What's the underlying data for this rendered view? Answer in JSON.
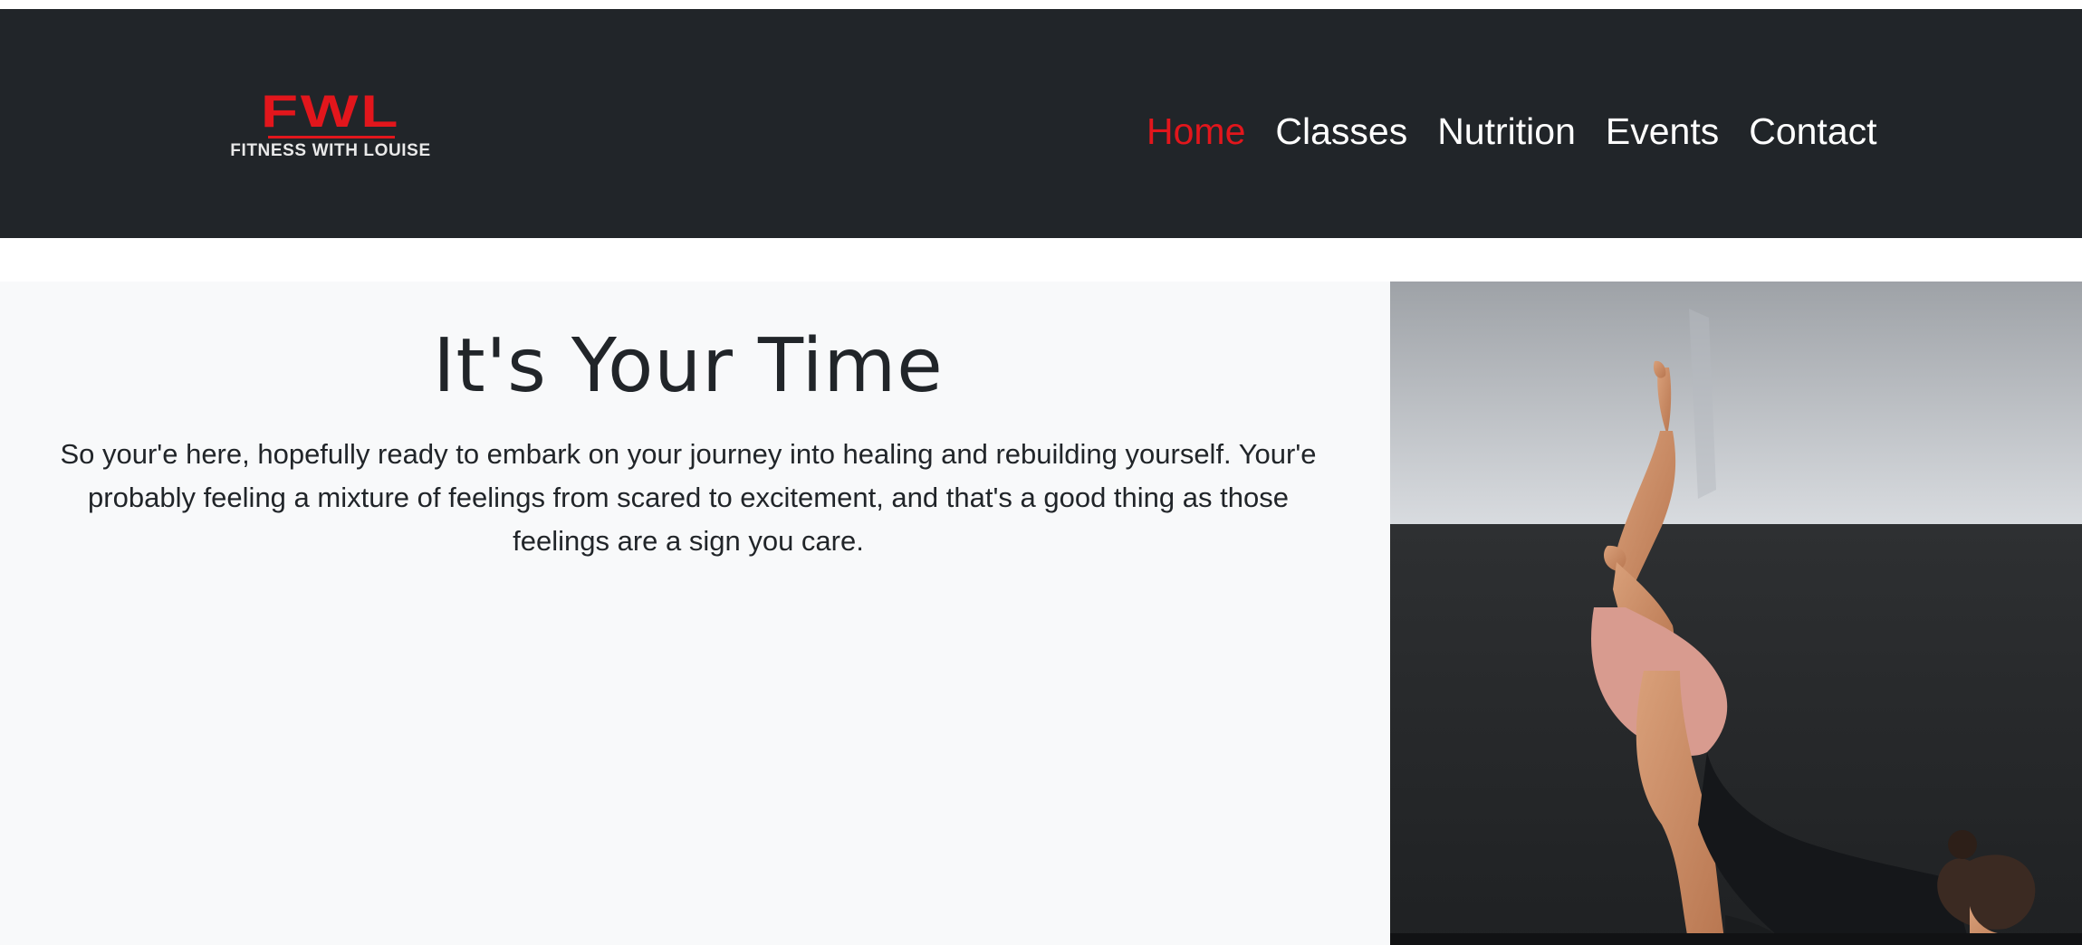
{
  "logo": {
    "mark": "FWL",
    "tagline": "FITNESS WITH LOUISE"
  },
  "nav": {
    "items": [
      {
        "label": "Home",
        "active": true
      },
      {
        "label": "Classes",
        "active": false
      },
      {
        "label": "Nutrition",
        "active": false
      },
      {
        "label": "Events",
        "active": false
      },
      {
        "label": "Contact",
        "active": false
      }
    ]
  },
  "hero": {
    "title": "It's Your Time",
    "text": "So your'e here, hopefully ready to embark on your journey into healing and rebuilding yourself. Your'e probably feeling a mixture of feelings from scared to excitement, and that's a good thing as those feelings are a sign you care."
  },
  "colors": {
    "navbar_bg": "#212529",
    "accent": "#e2161c",
    "hero_bg": "#f8f9fa",
    "text": "#212529"
  }
}
